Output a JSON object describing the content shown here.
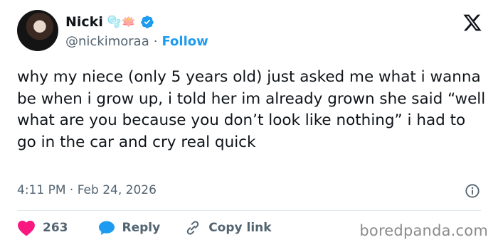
{
  "author": {
    "name": "Nicki",
    "name_emojis": "🫧🪷",
    "handle": "@nickimoraa",
    "separator": "·",
    "follow_label": "Follow"
  },
  "icons": {
    "verified": "verified-badge-icon",
    "platform": "x-logo-icon",
    "info": "info-icon",
    "like": "heart-icon",
    "reply": "reply-bubble-icon",
    "copy_link": "link-icon"
  },
  "tweet": {
    "text": "why my niece (only 5 years old) just asked me what i wanna be when i grow up, i told her im already grown she said “well what are you because you don’t look like nothing” i had to go in the car and cry real quick",
    "timestamp": "4:11 PM · Feb 24, 2026"
  },
  "actions": {
    "like_count": "263",
    "reply_label": "Reply",
    "copy_link_label": "Copy link"
  },
  "watermark": "boredpanda.com",
  "colors": {
    "accent": "#1d9bf0",
    "like": "#f91880",
    "text": "#0f1419",
    "muted": "#536471"
  }
}
